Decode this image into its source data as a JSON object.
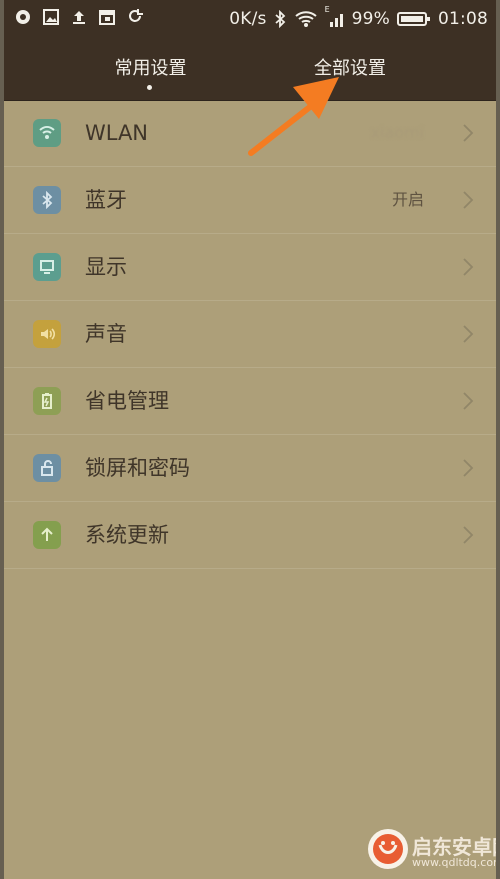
{
  "status_bar": {
    "network_speed": "0K/s",
    "signal_label": "E",
    "battery": "99%",
    "time": "01:08",
    "icons": [
      "message-icon",
      "image-icon",
      "upload-icon",
      "calendar-icon",
      "sync-icon",
      "bluetooth-icon",
      "wifi-icon",
      "signal-icon",
      "battery-icon"
    ]
  },
  "tabs": {
    "common": "常用设置",
    "all": "全部设置"
  },
  "settings": [
    {
      "label": "WLAN",
      "value": "xiaomi",
      "icon": "wifi-icon",
      "color": "#5f9d84"
    },
    {
      "label": "蓝牙",
      "value": "开启",
      "icon": "bluetooth-icon",
      "color": "#6d8fa3"
    },
    {
      "label": "显示",
      "value": "",
      "icon": "display-icon",
      "color": "#5c9e8f"
    },
    {
      "label": "声音",
      "value": "",
      "icon": "sound-icon",
      "color": "#c4a13d"
    },
    {
      "label": "省电管理",
      "value": "",
      "icon": "battery-saver-icon",
      "color": "#8e9f55"
    },
    {
      "label": "锁屏和密码",
      "value": "",
      "icon": "unlock-icon",
      "color": "#6d8fa3"
    },
    {
      "label": "系统更新",
      "value": "",
      "icon": "update-arrow-icon",
      "color": "#849f4e"
    }
  ],
  "watermark": {
    "title": "启东安卓网",
    "url": "www.qdltdq.com"
  },
  "colors": {
    "header": "#3d3024",
    "background": "#ad9f79",
    "divider": "#b7ab89",
    "annotation_arrow": "#f47c22"
  }
}
